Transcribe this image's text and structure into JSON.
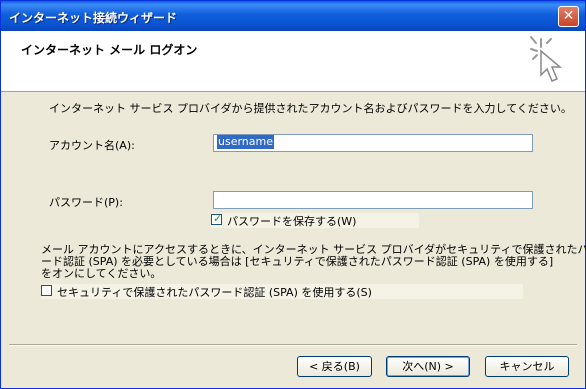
{
  "window": {
    "title": "インターネット接続ウィザード"
  },
  "header": {
    "title": "インターネット メール ログオン",
    "icon": "wizard-cursor-icon"
  },
  "intro": "インターネット サービス プロバイダから提供されたアカウント名およびパスワードを入力してください。",
  "account": {
    "label": "アカウント名(A):",
    "value": "username"
  },
  "password": {
    "label": "パスワード(P):",
    "value": ""
  },
  "save_password": {
    "label": "パスワードを保存する(W)",
    "checked": true
  },
  "spa_note": {
    "line1": "メール アカウントにアクセスするときに、インターネット サービス プロバイダがセキュリティで保護されたパスワ",
    "line2": "ード認証 (SPA) を必要としている場合は [セキュリティで保護されたパスワード認証 (SPA) を使用する]",
    "line3": "をオンにしてください。"
  },
  "spa_checkbox": {
    "label": "セキュリティで保護されたパスワード認証 (SPA) を使用する(S)",
    "checked": false
  },
  "buttons": {
    "back": "< 戻る(B)",
    "next": "次へ(N) >",
    "cancel": "キャンセル"
  }
}
